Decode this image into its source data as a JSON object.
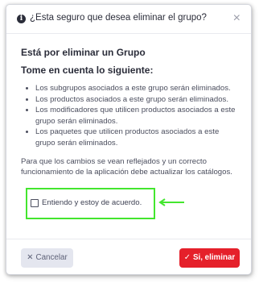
{
  "dialog": {
    "title": "¿Esta seguro que desea eliminar el grupo?",
    "heading": "Está por eliminar un Grupo",
    "subheading": "Tome en cuenta lo siguiente:",
    "bullets": [
      "Los subgrupos asociados a este grupo serán eliminados.",
      "Los productos asociados a este grupo serán eliminados.",
      "Los modificadores que utilicen productos asociados a este grupo serán eliminados.",
      "Los paquetes que utilicen productos asociados a este grupo serán eliminados."
    ],
    "note": "Para que los cambios se vean reflejados y un correcto funcionamiento de la aplicación debe actualizar los catálogos.",
    "checkbox_label": "Entiendo y estoy de acuerdo.",
    "checkbox_checked": false,
    "cancel_label": "Cancelar",
    "confirm_label": "Si, eliminar"
  },
  "icons": {
    "header": "info-circle-icon",
    "close": "close-icon",
    "cancel": "x-icon",
    "confirm": "check-icon",
    "annotation": "arrow-left-icon"
  },
  "colors": {
    "confirm_button": "#e5202a",
    "cancel_button": "#e4e6ef",
    "annotation": "#43e62e"
  }
}
